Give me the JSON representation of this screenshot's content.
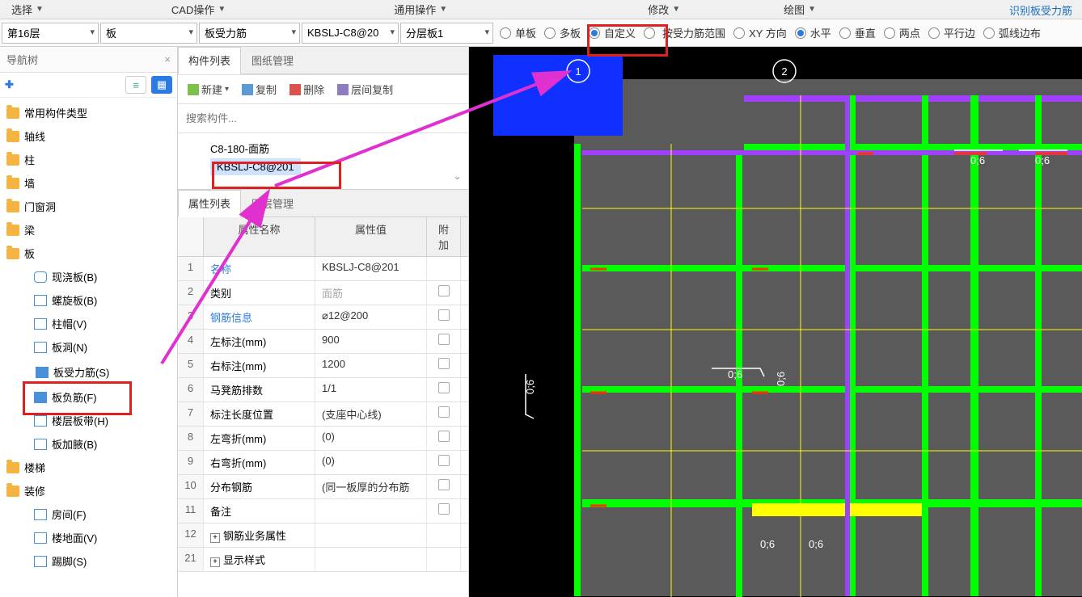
{
  "ribbon": {
    "tabs": [
      "选择",
      "CAD操作",
      "通用操作",
      "修改",
      "绘图"
    ],
    "right_group": "识别板受力筋"
  },
  "toolbar": {
    "floor": "第16层",
    "category": "板",
    "component_type": "板受力筋",
    "component_name": "KBSLJ-C8@20",
    "layer": "分层板1",
    "radios1": [
      {
        "label": "单板",
        "sel": false
      },
      {
        "label": "多板",
        "sel": false
      },
      {
        "label": "自定义",
        "sel": true
      }
    ],
    "radios2": [
      {
        "label": "按受力筋范围",
        "sel": false
      },
      {
        "label": "XY 方向",
        "sel": false
      },
      {
        "label": "水平",
        "sel": true
      },
      {
        "label": "垂直",
        "sel": false
      },
      {
        "label": "两点",
        "sel": false
      },
      {
        "label": "平行边",
        "sel": false
      },
      {
        "label": "弧线边布",
        "sel": false
      }
    ]
  },
  "nav": {
    "title": "导航树",
    "items": [
      {
        "label": "常用构件类型",
        "type": "folder"
      },
      {
        "label": "轴线",
        "type": "folder"
      },
      {
        "label": "柱",
        "type": "folder"
      },
      {
        "label": "墙",
        "type": "folder"
      },
      {
        "label": "门窗洞",
        "type": "folder"
      },
      {
        "label": "梁",
        "type": "folder"
      },
      {
        "label": "板",
        "type": "folder"
      },
      {
        "label": "现浇板(B)",
        "type": "sub",
        "ic": "s1"
      },
      {
        "label": "螺旋板(B)",
        "type": "sub",
        "ic": "s2"
      },
      {
        "label": "柱帽(V)",
        "type": "sub",
        "ic": "s2"
      },
      {
        "label": "板洞(N)",
        "type": "sub",
        "ic": "s2"
      },
      {
        "label": "板受力筋(S)",
        "type": "sub",
        "ic": "s3",
        "sel": true
      },
      {
        "label": "板负筋(F)",
        "type": "sub",
        "ic": "s3"
      },
      {
        "label": "楼层板带(H)",
        "type": "sub",
        "ic": "s2"
      },
      {
        "label": "板加腋(B)",
        "type": "sub",
        "ic": "s2"
      },
      {
        "label": "楼梯",
        "type": "folder"
      },
      {
        "label": "装修",
        "type": "folder"
      },
      {
        "label": "房间(F)",
        "type": "sub",
        "ic": "s2"
      },
      {
        "label": "楼地面(V)",
        "type": "sub",
        "ic": "s2"
      },
      {
        "label": "踢脚(S)",
        "type": "sub",
        "ic": "s2"
      }
    ]
  },
  "components": {
    "tab1": "构件列表",
    "tab2": "图纸管理",
    "btn_new": "新建",
    "btn_copy": "复制",
    "btn_delete": "删除",
    "btn_floor_copy": "层间复制",
    "search_placeholder": "搜索构件...",
    "list": [
      "C8-180-面筋",
      "KBSLJ-C8@201"
    ]
  },
  "properties": {
    "tab1": "属性列表",
    "tab2": "图层管理",
    "header": {
      "name": "属性名称",
      "value": "属性值",
      "att": "附加"
    },
    "rows": [
      {
        "n": "1",
        "name": "名称",
        "val": "KBSLJ-C8@201",
        "link": true
      },
      {
        "n": "2",
        "name": "类别",
        "val": "面筋",
        "gray": true,
        "chk": true
      },
      {
        "n": "3",
        "name": "钢筋信息",
        "val": "⌀12@200",
        "link": true,
        "chk": true
      },
      {
        "n": "4",
        "name": "左标注(mm)",
        "val": "900",
        "chk": true
      },
      {
        "n": "5",
        "name": "右标注(mm)",
        "val": "1200",
        "chk": true
      },
      {
        "n": "6",
        "name": "马凳筋排数",
        "val": "1/1",
        "chk": true
      },
      {
        "n": "7",
        "name": "标注长度位置",
        "val": "(支座中心线)",
        "chk": true
      },
      {
        "n": "8",
        "name": "左弯折(mm)",
        "val": "(0)",
        "chk": true
      },
      {
        "n": "9",
        "name": "右弯折(mm)",
        "val": "(0)",
        "chk": true
      },
      {
        "n": "10",
        "name": "分布钢筋",
        "val": "(同一板厚的分布筋",
        "chk": true
      },
      {
        "n": "11",
        "name": "备注",
        "val": "",
        "chk": true
      },
      {
        "n": "12",
        "name": "钢筋业务属性",
        "val": "",
        "exp": true
      },
      {
        "n": "21",
        "name": "显示样式",
        "val": "",
        "exp": true
      }
    ]
  },
  "canvas_labels": {
    "a": "0;6",
    "b": "0;6",
    "c": "0;6",
    "d": "0;6",
    "e": "0;6",
    "f": "0;6",
    "g": "0;6"
  }
}
